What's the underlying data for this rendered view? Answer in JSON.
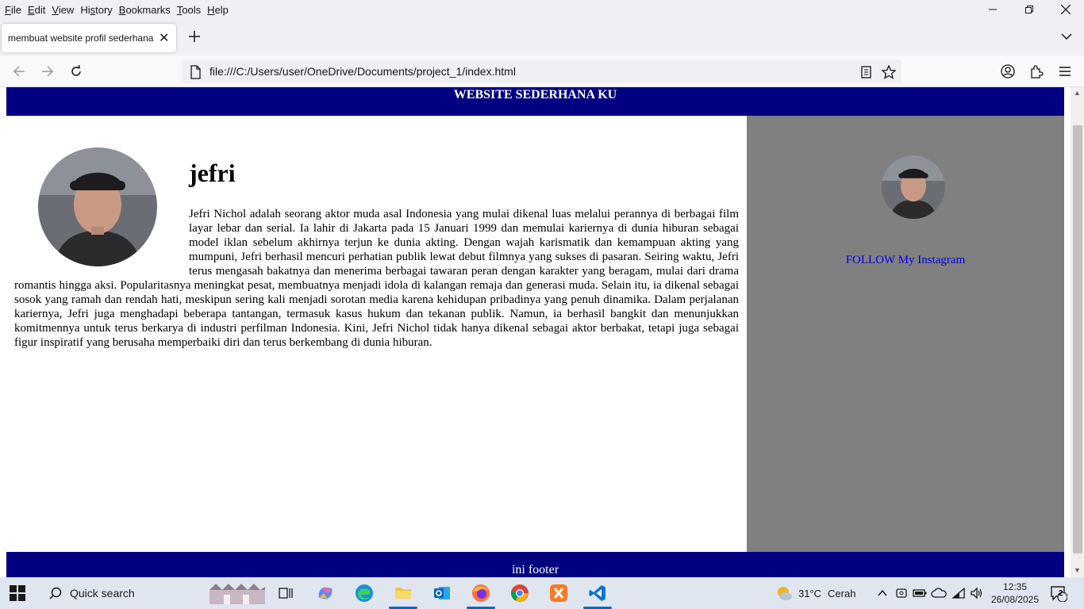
{
  "menu": {
    "items": [
      {
        "label": "File",
        "key": "F",
        "rest": "ile"
      },
      {
        "label": "Edit",
        "key": "E",
        "rest": "dit"
      },
      {
        "label": "View",
        "key": "V",
        "rest": "iew"
      },
      {
        "label": "History",
        "key": "s",
        "pre": "Hi",
        "rest": "tory"
      },
      {
        "label": "Bookmarks",
        "key": "B",
        "rest": "ookmarks"
      },
      {
        "label": "Tools",
        "key": "T",
        "rest": "ools"
      },
      {
        "label": "Help",
        "key": "H",
        "rest": "elp"
      }
    ]
  },
  "tab": {
    "title": "membuat website profil sederhana",
    "close_glyph": "✕"
  },
  "nav": {
    "url": "file:///C:/Users/user/OneDrive/Documents/project_1/index.html"
  },
  "page": {
    "header_title": "WEBSITE SEDERHANA KU",
    "profile_name": "jefri",
    "profile_bio": "Jefri Nichol adalah seorang aktor muda asal Indonesia yang mulai dikenal luas melalui perannya di berbagai film layar lebar dan serial. Ia lahir di Jakarta pada 15 Januari 1999 dan memulai kariernya di dunia hiburan sebagai model iklan sebelum akhirnya terjun ke dunia akting. Dengan wajah karismatik dan kemampuan akting yang mumpuni, Jefri berhasil mencuri perhatian publik lewat debut filmnya yang sukses di pasaran. Seiring waktu, Jefri terus mengasah bakatnya dan menerima berbagai tawaran peran dengan karakter yang beragam, mulai dari drama romantis hingga aksi. Popularitasnya meningkat pesat, membuatnya menjadi idola di kalangan remaja dan generasi muda. Selain itu, ia dikenal sebagai sosok yang ramah dan rendah hati, meskipun sering kali menjadi sorotan media karena kehidupan pribadinya yang penuh dinamika. Dalam perjalanan kariernya, Jefri juga menghadapi beberapa tantangan, termasuk kasus hukum dan tekanan publik. Namun, ia berhasil bangkit dan menunjukkan komitmennya untuk terus berkarya di industri perfilman Indonesia. Kini, Jefri Nichol tidak hanya dikenal sebagai aktor berbakat, tetapi juga sebagai figur inspiratif yang berusaha memperbaiki diri dan terus berkembang di dunia hiburan.",
    "sidebar_link": "FOLLOW My Instagram",
    "footer_text": "ini footer"
  },
  "taskbar": {
    "search_label": "Quick search",
    "weather_temp": "31°C",
    "weather_desc": "Cerah",
    "time": "12:35",
    "date": "26/08/2025",
    "notification_count": "2"
  },
  "colors": {
    "site_header_bg": "#000080",
    "sidebar_bg": "#808080",
    "link": "#0000ee"
  }
}
